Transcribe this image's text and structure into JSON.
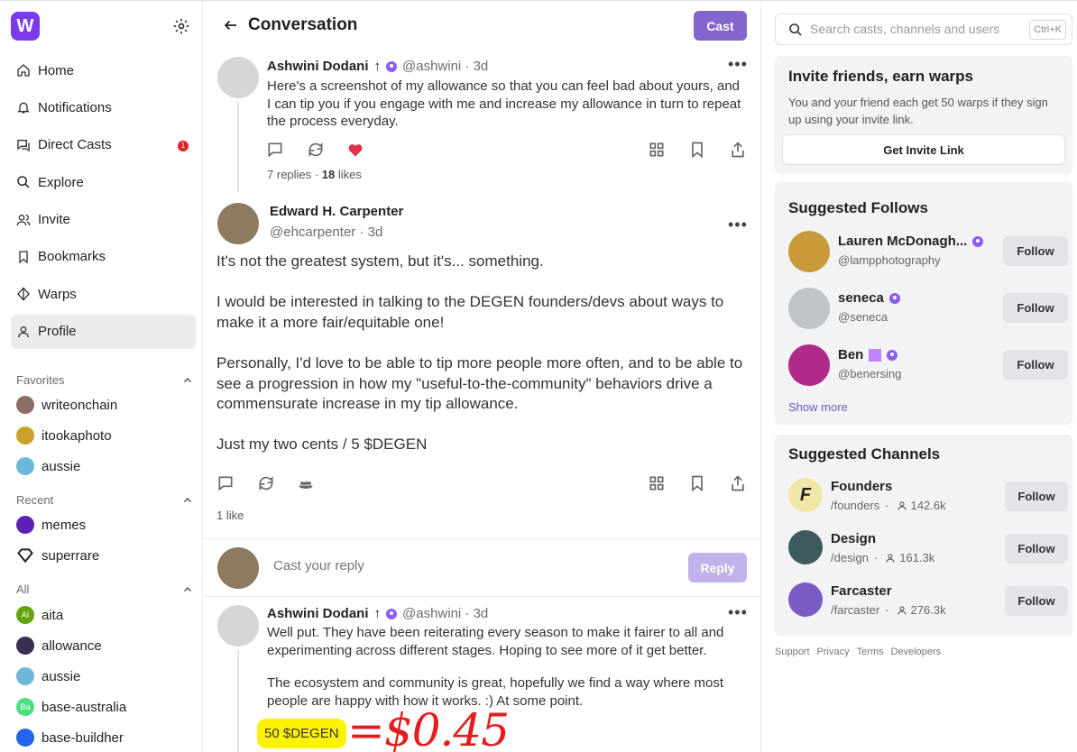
{
  "brand": {
    "logo_letter": "W",
    "accent": "#7c3aed"
  },
  "sidebar": {
    "nav": [
      {
        "label": "Home",
        "icon": "home-icon"
      },
      {
        "label": "Notifications",
        "icon": "bell-icon"
      },
      {
        "label": "Direct Casts",
        "icon": "chat-icon",
        "badge": "1"
      },
      {
        "label": "Explore",
        "icon": "search-icon"
      },
      {
        "label": "Invite",
        "icon": "users-icon"
      },
      {
        "label": "Bookmarks",
        "icon": "bookmark-icon"
      },
      {
        "label": "Warps",
        "icon": "diamond-icon"
      },
      {
        "label": "Profile",
        "icon": "user-icon",
        "active": true
      }
    ],
    "favorites_label": "Favorites",
    "favorites": [
      "writeonchain",
      "itookaphoto",
      "aussie"
    ],
    "recent_label": "Recent",
    "recent": [
      "memes",
      "superrare"
    ],
    "all_label": "All",
    "all": [
      "aita",
      "allowance",
      "aussie",
      "base-australia",
      "base-buildher"
    ]
  },
  "main": {
    "title": "Conversation",
    "cast_label": "Cast",
    "parent": {
      "name": "Ashwini Dodani",
      "arrow": "↑",
      "handle": "@ashwini · 3d",
      "text": "Here's a screenshot of my allowance so that you can feel bad about yours, and I can tip you if you engage with me and increase my allowance in turn to repeat the process everyday.",
      "replies_count": "7",
      "replies_label": "replies",
      "likes_count": "18",
      "likes_label": "likes"
    },
    "focus": {
      "name": "Edward H. Carpenter",
      "handle": "@ehcarpenter · 3d",
      "p1": "It's not the greatest system, but it's... something.",
      "p2": "I would be interested in talking to the DEGEN founders/devs about ways to make it a more fair/equitable one!",
      "p3": "Personally, I'd love to be able to tip more people more often, and to be able to see a progression in how my \"useful-to-the-community\" behaviors drive a commensurate increase in my tip allowance.",
      "p4": "Just my two cents / 5 $DEGEN",
      "likes": "1 like"
    },
    "reply_placeholder": "Cast your reply",
    "reply_label": "Reply",
    "reply": {
      "name": "Ashwini Dodani",
      "arrow": "↑",
      "handle": "@ashwini · 3d",
      "p1": "Well put. They have been reiterating every season to make it fairer to all and experimenting across different stages. Hoping to see more of it get better.",
      "p2": "The ecosystem and community is great, hopefully we find a way where most people are happy with how it works. :) At some point.",
      "highlight": "50 $DEGEN",
      "annotation": "=$0.45"
    }
  },
  "right": {
    "search_placeholder": "Search casts, channels and users",
    "search_kbd": "Ctrl+K",
    "invite": {
      "title": "Invite friends, earn warps",
      "desc": "You and your friend each get 50 warps if they sign up using your invite link.",
      "button": "Get Invite Link"
    },
    "follows_title": "Suggested Follows",
    "follows": [
      {
        "name": "Lauren McDonagh...",
        "handle": "@lampphotography"
      },
      {
        "name": "seneca",
        "handle": "@seneca"
      },
      {
        "name": "Ben",
        "handle": "@benersing"
      }
    ],
    "follow_label": "Follow",
    "show_more": "Show more",
    "channels_title": "Suggested Channels",
    "channels": [
      {
        "name": "Founders",
        "path": "/founders",
        "sep": "·",
        "count": "142.6k"
      },
      {
        "name": "Design",
        "path": "/design",
        "sep": "·",
        "count": "161.3k"
      },
      {
        "name": "Farcaster",
        "path": "/farcaster",
        "sep": "·",
        "count": "276.3k"
      }
    ],
    "footer": [
      "Support",
      "Privacy",
      "Terms",
      "Developers"
    ]
  }
}
